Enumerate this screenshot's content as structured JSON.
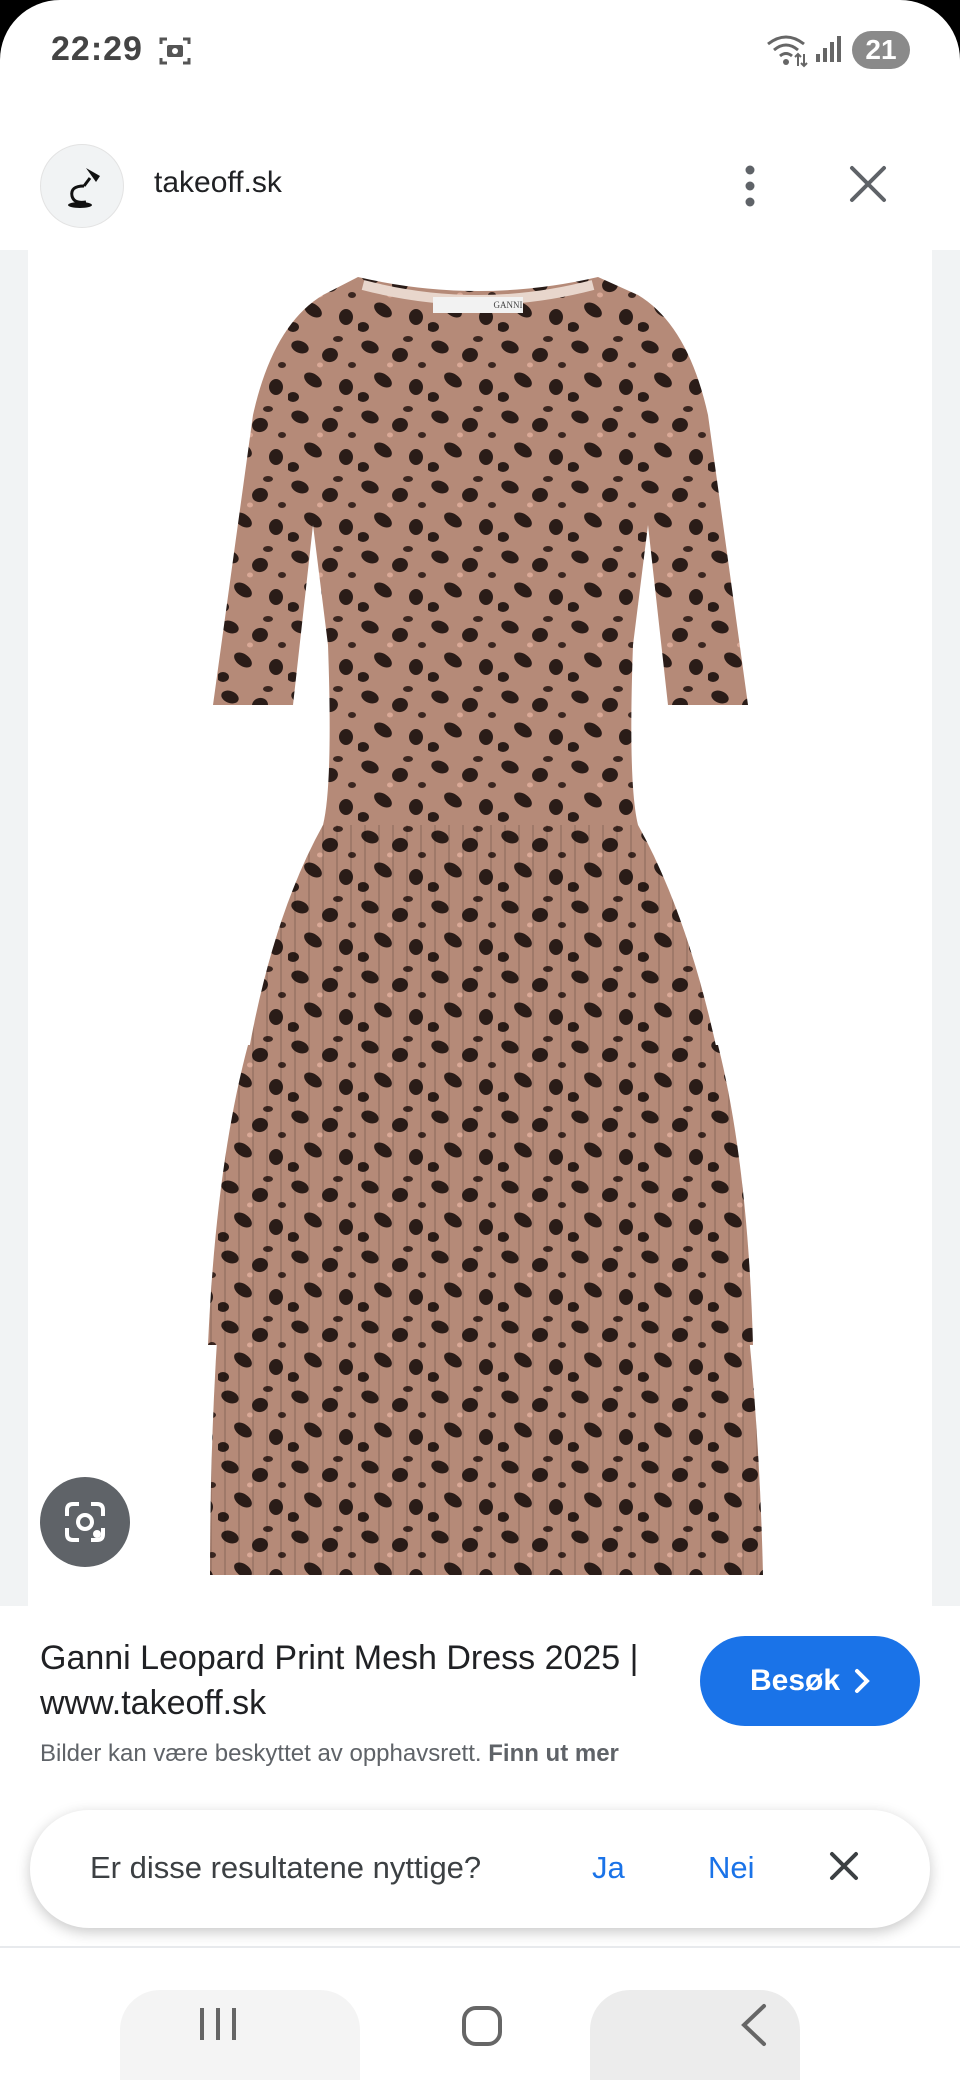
{
  "status_bar": {
    "time": "22:29",
    "battery": "21",
    "icons": [
      "screenshot-icon",
      "wifi-icon",
      "signal-icon"
    ]
  },
  "header": {
    "site_name": "takeoff.sk",
    "menu_icon": "more-vert-icon",
    "close_icon": "close-icon"
  },
  "image": {
    "brand_label": "GANNI",
    "lens_icon": "google-lens-icon"
  },
  "result": {
    "title": "Ganni Leopard Print Mesh Dress 2025 | www.takeoff.sk",
    "copyright_text": "Bilder kan være beskyttet av opphavsrett.",
    "learn_more": "Finn ut mer",
    "visit_label": "Besøk",
    "accent_color": "#1a73e8"
  },
  "feedback": {
    "question": "Er disse resultatene nyttige?",
    "yes": "Ja",
    "no": "Nei"
  },
  "nav": {
    "icons": [
      "recent-apps-icon",
      "home-icon",
      "back-icon"
    ]
  }
}
